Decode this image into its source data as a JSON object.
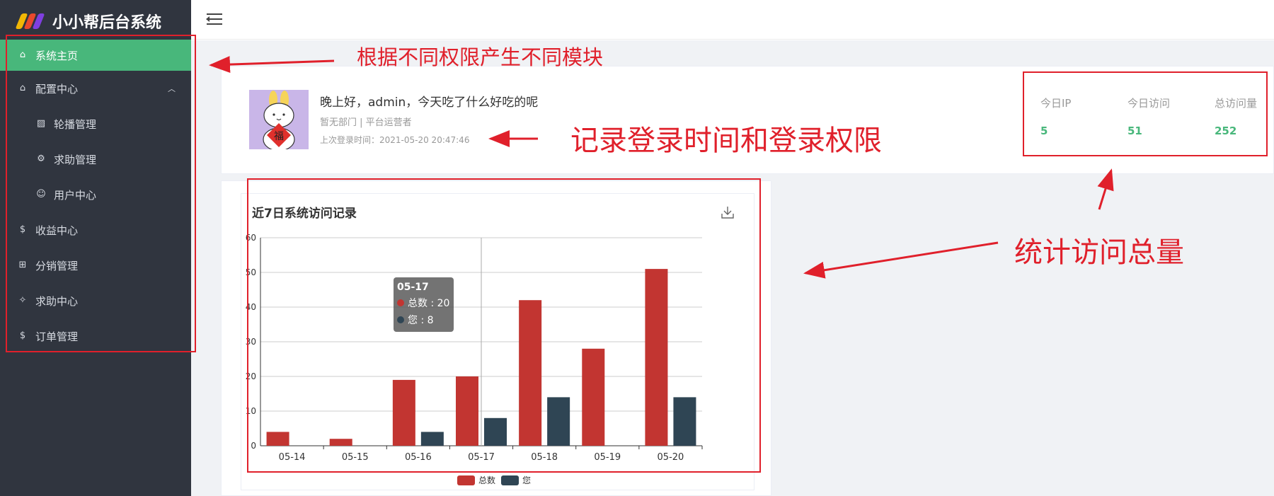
{
  "app": {
    "title": "小小帮后台系统"
  },
  "sidebar": {
    "items": [
      {
        "label": "系统主页",
        "icon": "home-icon",
        "active": true
      },
      {
        "label": "配置中心",
        "icon": "home-icon",
        "expanded": true
      },
      {
        "label": "轮播管理",
        "icon": "image-icon",
        "sub": true
      },
      {
        "label": "求助管理",
        "icon": "gear-icon",
        "sub": true
      },
      {
        "label": "用户中心",
        "icon": "smile-icon",
        "sub": true
      },
      {
        "label": "收益中心",
        "icon": "coin-icon"
      },
      {
        "label": "分销管理",
        "icon": "tree-icon"
      },
      {
        "label": "求助中心",
        "icon": "badge-icon"
      },
      {
        "label": "订单管理",
        "icon": "coin-icon"
      }
    ]
  },
  "profile": {
    "greeting": "晚上好，admin，今天吃了什么好吃的呢",
    "dept": "暂无部门 | 平台运营者",
    "last_login": "上次登录时间：2021-05-20 20:47:46"
  },
  "stats": [
    {
      "label": "今日IP",
      "value": "5"
    },
    {
      "label": "今日访问",
      "value": "51"
    },
    {
      "label": "总访问量",
      "value": "252"
    }
  ],
  "chart_card": {
    "title": "近7日系统访问记录"
  },
  "chart_data": {
    "type": "bar",
    "categories": [
      "05-14",
      "05-15",
      "05-16",
      "05-17",
      "05-18",
      "05-19",
      "05-20"
    ],
    "series": [
      {
        "name": "总数",
        "values": [
          4,
          2,
          19,
          20,
          42,
          28,
          51
        ],
        "color": "#c23531"
      },
      {
        "name": "您",
        "values": [
          0,
          0,
          4,
          8,
          14,
          0,
          14
        ],
        "color": "#2f4554"
      }
    ],
    "ylim": [
      0,
      60
    ],
    "yticks": [
      0,
      10,
      20,
      30,
      40,
      50,
      60
    ],
    "grid": true,
    "legend": "bottom",
    "tooltip": {
      "title": "05-17",
      "rows": [
        "总数 : 20",
        "您 : 8"
      ]
    }
  },
  "annotations": {
    "modules": "根据不同权限产生不同模块",
    "login": "记录登录时间和登录权限",
    "stats": "统计访问总量"
  },
  "colors": {
    "sidebar_bg": "#30353f",
    "accent": "#48b77b",
    "annotation": "#e0202b"
  }
}
